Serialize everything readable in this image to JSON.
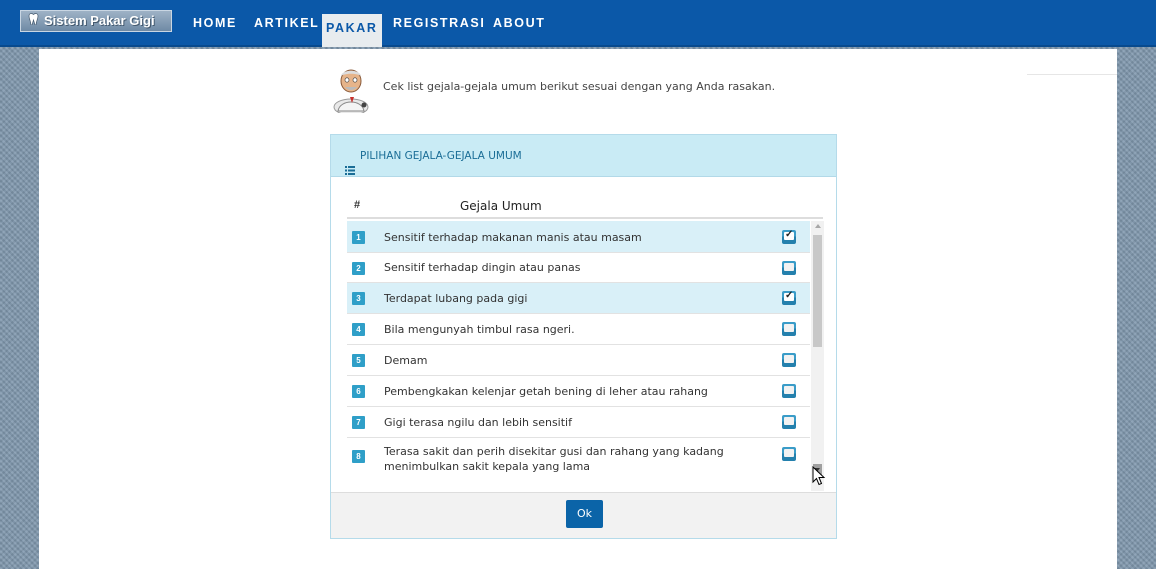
{
  "nav": {
    "brand": "Sistem Pakar Gigi",
    "items": [
      {
        "label": "HOME"
      },
      {
        "label": "ARTIKEL"
      },
      {
        "label": "PAKAR"
      },
      {
        "label": "REGISTRASI"
      },
      {
        "label": "ABOUT"
      }
    ],
    "active": "PAKAR"
  },
  "intro": "Cek list gejala-gejala umum berikut sesuai dengan yang Anda rasakan.",
  "panel": {
    "title": "PILIHAN GEJALA-GEJALA UMUM",
    "columns": [
      "#",
      "Gejala Umum"
    ],
    "rows": [
      {
        "num": "1",
        "text": "Sensitif terhadap makanan manis atau masam",
        "checked": true
      },
      {
        "num": "2",
        "text": "Sensitif terhadap dingin atau panas",
        "checked": false
      },
      {
        "num": "3",
        "text": "Terdapat lubang pada gigi",
        "checked": true
      },
      {
        "num": "4",
        "text": "Bila mengunyah timbul rasa ngeri.",
        "checked": false
      },
      {
        "num": "5",
        "text": "Demam",
        "checked": false
      },
      {
        "num": "6",
        "text": "Pembengkakan kelenjar getah bening di leher atau rahang",
        "checked": false
      },
      {
        "num": "7",
        "text": "Gigi terasa ngilu dan lebih sensitif",
        "checked": false
      },
      {
        "num": "8",
        "text": "Terasa sakit dan perih disekitar gusi dan rahang yang kadang menimbulkan sakit kepala yang lama",
        "checked": false
      }
    ],
    "ok_label": "Ok"
  },
  "colors": {
    "navbar": "#0b58a8",
    "panel_header": "#c9ebf5",
    "checked_row": "#d9f0f8",
    "number_badge": "#2f9fc8",
    "ok_button": "#0b64a8"
  }
}
